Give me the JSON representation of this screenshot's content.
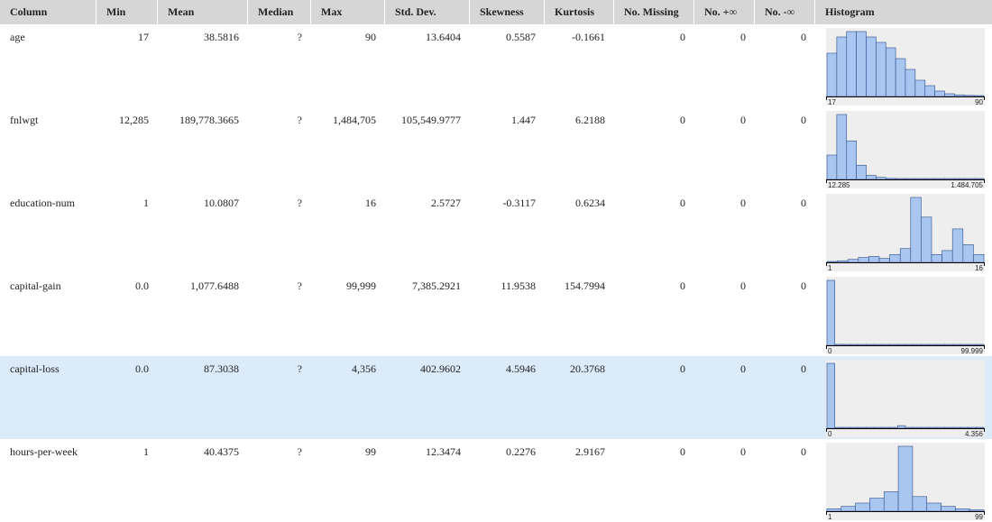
{
  "headers": [
    "Column",
    "Min",
    "Mean",
    "Median",
    "Max",
    "Std. Dev.",
    "Skewness",
    "Kurtosis",
    "No. Missing",
    "No. +∞",
    "No. -∞",
    "Histogram"
  ],
  "colors": {
    "bar_fill": "#a9c6f0",
    "bar_stroke": "#2d4f8a",
    "hist_bg": "#eeeeee",
    "selected_row": "#dcebfa"
  },
  "selected_row": 4,
  "rows": [
    {
      "column": "age",
      "min": "17",
      "mean": "38.5816",
      "median": "?",
      "max": "90",
      "std": "13.6404",
      "skew": "0.5587",
      "kurt": "-0.1661",
      "missing": "0",
      "pinf": "0",
      "ninf": "0",
      "hist": {
        "min_label": "17",
        "max_label": "90",
        "counts": [
          8,
          11,
          12,
          12,
          11,
          10,
          9,
          7,
          5,
          3,
          2,
          1,
          0.5,
          0.3,
          0.2,
          0.1
        ]
      }
    },
    {
      "column": "fnlwgt",
      "min": "12,285",
      "mean": "189,778.3665",
      "median": "?",
      "max": "1,484,705",
      "std": "105,549.9777",
      "skew": "1.447",
      "kurt": "6.2188",
      "missing": "0",
      "pinf": "0",
      "ninf": "0",
      "hist": {
        "min_label": "12.285",
        "max_label": "1.484.705",
        "counts": [
          12,
          32,
          19,
          7,
          2,
          1,
          0.5,
          0.4,
          0.3,
          0.2,
          0.2,
          0.1,
          0.1,
          0.1,
          0.1,
          0.1
        ]
      }
    },
    {
      "column": "education-num",
      "min": "1",
      "mean": "10.0807",
      "median": "?",
      "max": "16",
      "std": "2.5727",
      "skew": "-0.3117",
      "kurt": "0.6234",
      "missing": "0",
      "pinf": "0",
      "ninf": "0",
      "hist": {
        "min_label": "1",
        "max_label": "16",
        "counts": [
          0.3,
          0.8,
          1.5,
          2.5,
          3,
          2,
          4,
          7,
          33,
          23,
          4,
          6,
          17,
          9,
          4
        ]
      }
    },
    {
      "column": "capital-gain",
      "min": "0.0",
      "mean": "1,077.6488",
      "median": "?",
      "max": "99,999",
      "std": "7,385.2921",
      "skew": "11.9538",
      "kurt": "154.7994",
      "missing": "0",
      "pinf": "0",
      "ninf": "0",
      "hist": {
        "min_label": "0",
        "max_label": "99.999",
        "counts": [
          100,
          1.5,
          0.8,
          0.4,
          0.3,
          0.2,
          0.1,
          0.1,
          0.1,
          0.1,
          0.1,
          0.1,
          0.1,
          0.1,
          0.1,
          0.1,
          0.1,
          0.1,
          0.1,
          1
        ]
      }
    },
    {
      "column": "capital-loss",
      "min": "0.0",
      "mean": "87.3038",
      "median": "?",
      "max": "4,356",
      "std": "402.9602",
      "skew": "4.5946",
      "kurt": "20.3768",
      "missing": "0",
      "pinf": "0",
      "ninf": "0",
      "hist": {
        "min_label": "0",
        "max_label": "4.356",
        "counts": [
          100,
          0.2,
          0.2,
          0.2,
          0.3,
          0.5,
          0.5,
          0.8,
          1,
          4,
          1,
          0.5,
          0.3,
          0.2,
          0.2,
          0.2,
          0.1,
          0.1,
          0.1,
          0.3
        ]
      }
    },
    {
      "column": "hours-per-week",
      "min": "1",
      "mean": "40.4375",
      "median": "?",
      "max": "99",
      "std": "12.3474",
      "skew": "0.2276",
      "kurt": "2.9167",
      "missing": "0",
      "pinf": "0",
      "ninf": "0",
      "hist": {
        "min_label": "1",
        "max_label": "99",
        "counts": [
          1.5,
          3,
          5,
          8,
          12,
          40,
          9,
          5,
          3,
          1.5,
          0.8
        ]
      }
    }
  ]
}
